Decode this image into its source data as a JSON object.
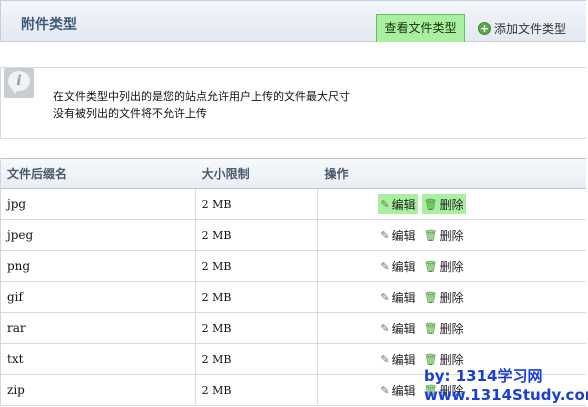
{
  "header": {
    "title": "附件类型",
    "tab_view_label": "查看文件类型",
    "tab_add_label": "添加文件类型"
  },
  "info": {
    "icon": "info-icon",
    "line1": "在文件类型中列出的是您的站点允许用户上传的文件最大尺寸",
    "line2": "没有被列出的文件将不允许上传"
  },
  "table": {
    "headers": [
      "文件后缀名",
      "大小限制",
      "操作"
    ],
    "edit_label": "编辑",
    "delete_label": "删除",
    "rows": [
      {
        "ext": "jpg",
        "size": "2 MB"
      },
      {
        "ext": "jpeg",
        "size": "2 MB"
      },
      {
        "ext": "png",
        "size": "2 MB"
      },
      {
        "ext": "gif",
        "size": "2 MB"
      },
      {
        "ext": "rar",
        "size": "2 MB"
      },
      {
        "ext": "txt",
        "size": "2 MB"
      },
      {
        "ext": "zip",
        "size": "2 MB"
      }
    ]
  },
  "watermark": {
    "line1": "by: 1314学习网",
    "line2": "www.1314Study.com"
  },
  "colors": {
    "highlight": "#a8f0a0",
    "header_text": "#3f5b7a",
    "watermark": "#1a3fd6"
  }
}
